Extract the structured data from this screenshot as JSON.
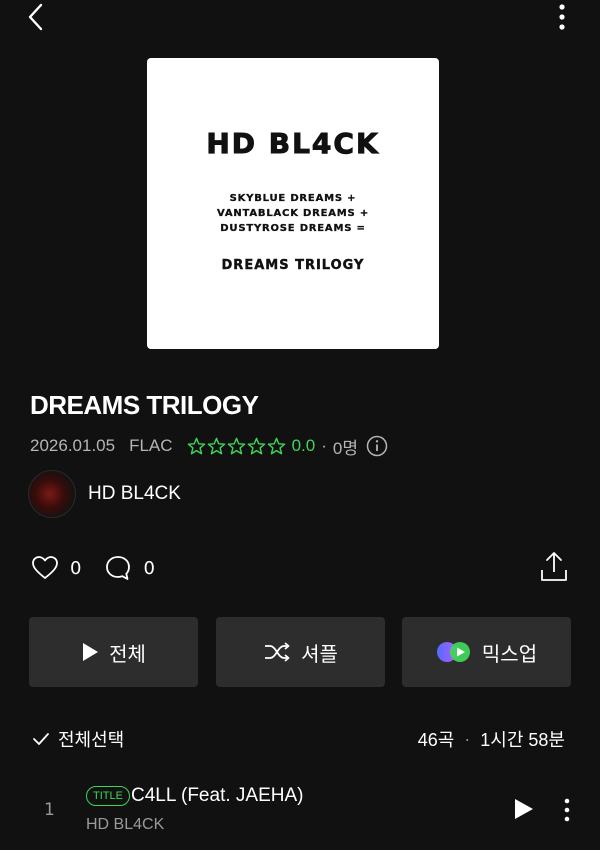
{
  "header": {
    "back_icon": "chevron-left-icon",
    "more_icon": "more-vertical-icon"
  },
  "cover": {
    "title": "HD BL4CK",
    "lines": [
      "SKYBLUE DREAMS +",
      "VANTABLACK DREAMS +",
      "DUSTYROSE DREAMS ="
    ],
    "subtitle": "DREAMS TRILOGY"
  },
  "album": {
    "title": "DREAMS TRILOGY",
    "date": "2026.01.05",
    "format": "FLAC",
    "rating": "0.0",
    "rating_count": "0명",
    "star_count": 5,
    "star_color": "#3fd45a"
  },
  "artist": {
    "name": "HD BL4CK"
  },
  "social": {
    "likes": "0",
    "comments": "0"
  },
  "buttons": {
    "play_all": "전체",
    "shuffle": "셔플",
    "mixup": "믹스업"
  },
  "list": {
    "select_all": "전체선택",
    "track_count": "46곡",
    "duration": "1시간 58분"
  },
  "tracks": [
    {
      "number": "1",
      "badge": "TITLE",
      "title": "C4LL (Feat. JAEHA)",
      "artist": "HD BL4CK"
    }
  ],
  "colors": {
    "background": "#111111",
    "accent": "#3fd45a",
    "button_bg": "#2d2d2d"
  }
}
